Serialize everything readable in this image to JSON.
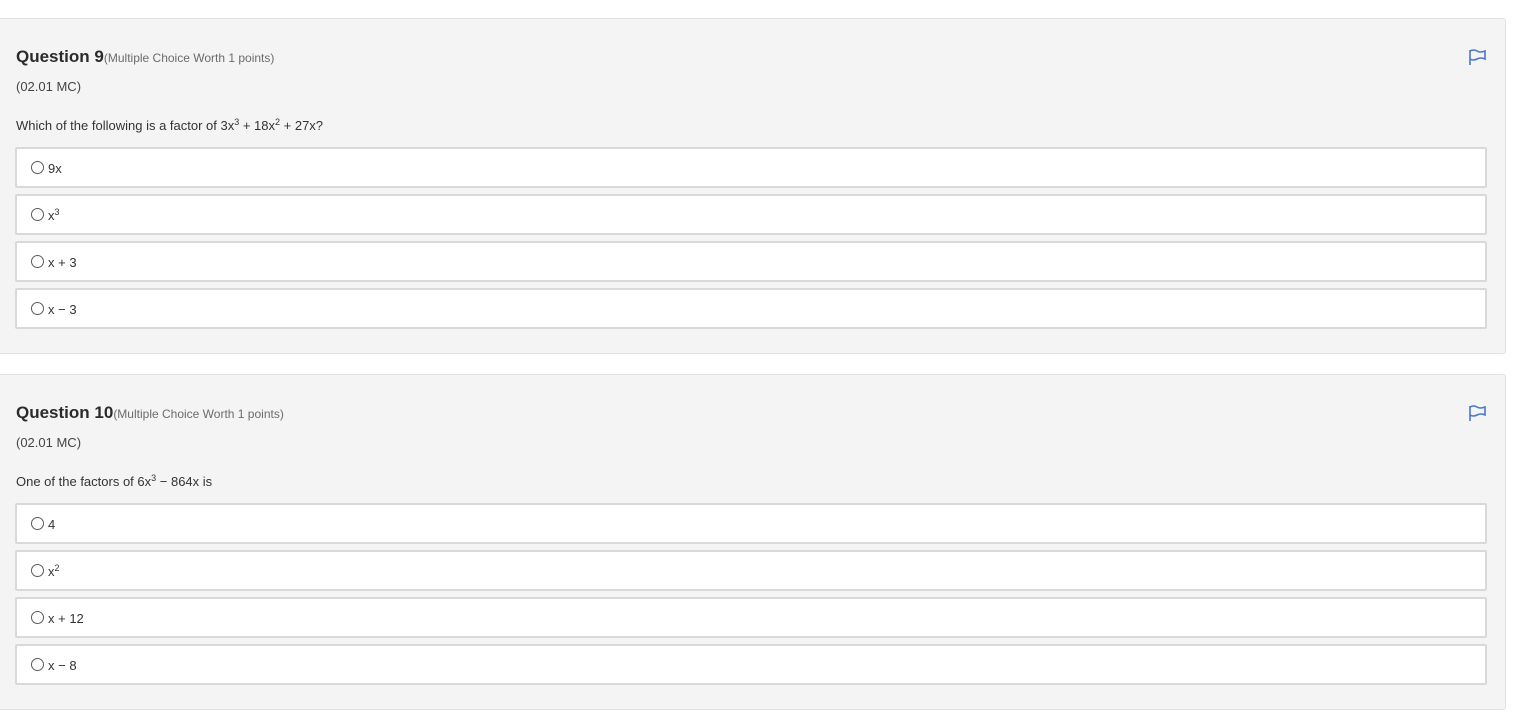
{
  "questions": [
    {
      "number_label": "Question 9",
      "meta": "(Multiple Choice Worth 1 points)",
      "code": "(02.01 MC)",
      "prompt": {
        "t1": "Which of the following is a factor of 3x",
        "s1": "3",
        "t2": " + 18x",
        "s2": "2",
        "t3": " + 27x?"
      },
      "flag_icon": "flag-icon",
      "choices": [
        {
          "base": "9x",
          "sup": "",
          "rest": ""
        },
        {
          "base": "x",
          "sup": "3",
          "rest": ""
        },
        {
          "base": "x + 3",
          "sup": "",
          "rest": ""
        },
        {
          "base": "x − 3",
          "sup": "",
          "rest": ""
        }
      ]
    },
    {
      "number_label": "Question 10",
      "meta": "(Multiple Choice Worth 1 points)",
      "code": "(02.01 MC)",
      "prompt": {
        "t1": "One of the factors of 6x",
        "s1": "3",
        "t2": " − 864x is",
        "s2": "",
        "t3": ""
      },
      "flag_icon": "flag-icon",
      "choices": [
        {
          "base": "4",
          "sup": "",
          "rest": ""
        },
        {
          "base": "x",
          "sup": "2",
          "rest": ""
        },
        {
          "base": "x + 12",
          "sup": "",
          "rest": ""
        },
        {
          "base": "x − 8",
          "sup": "",
          "rest": ""
        }
      ]
    }
  ],
  "colors": {
    "panel_bg": "#f4f4f4",
    "flag": "#4a78c9",
    "choice_border": "#d9d9d9"
  }
}
